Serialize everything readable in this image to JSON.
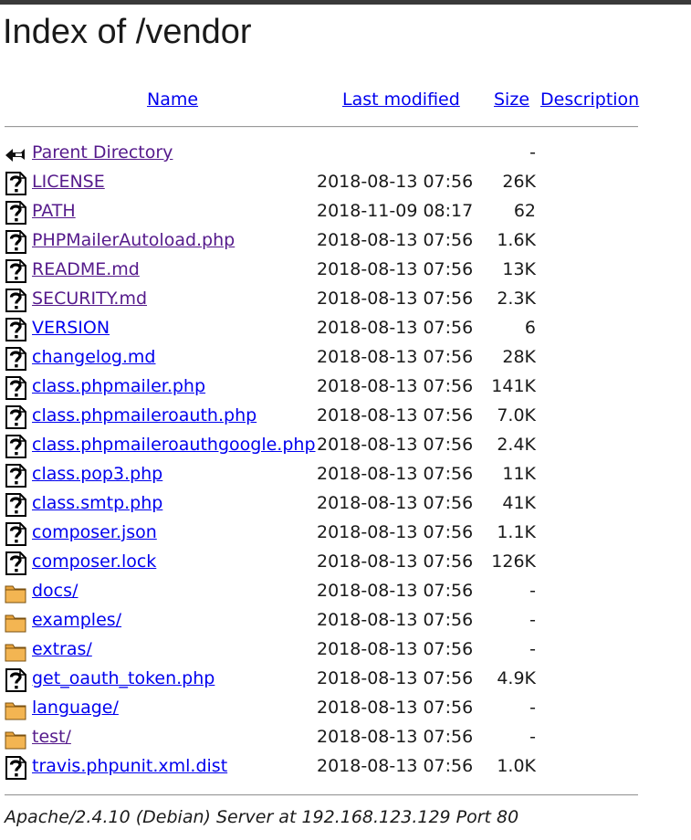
{
  "page": {
    "title": "Index of /vendor"
  },
  "columns": {
    "name": "Name",
    "last_modified": "Last modified",
    "size": "Size",
    "description": "Description"
  },
  "parent": {
    "label": "Parent Directory",
    "size": "-"
  },
  "entries": [
    {
      "name": "LICENSE",
      "modified": "2018-08-13 07:56",
      "size": "26K",
      "icon": "file-unknown-icon",
      "visited": true
    },
    {
      "name": "PATH",
      "modified": "2018-11-09 08:17",
      "size": "62",
      "icon": "file-unknown-icon",
      "visited": true
    },
    {
      "name": "PHPMailerAutoload.php",
      "modified": "2018-08-13 07:56",
      "size": "1.6K",
      "icon": "file-unknown-icon",
      "visited": true
    },
    {
      "name": "README.md",
      "modified": "2018-08-13 07:56",
      "size": "13K",
      "icon": "file-unknown-icon",
      "visited": true
    },
    {
      "name": "SECURITY.md",
      "modified": "2018-08-13 07:56",
      "size": "2.3K",
      "icon": "file-unknown-icon",
      "visited": true
    },
    {
      "name": "VERSION",
      "modified": "2018-08-13 07:56",
      "size": "6",
      "icon": "file-unknown-icon",
      "visited": false
    },
    {
      "name": "changelog.md",
      "modified": "2018-08-13 07:56",
      "size": "28K",
      "icon": "file-unknown-icon",
      "visited": false
    },
    {
      "name": "class.phpmailer.php",
      "modified": "2018-08-13 07:56",
      "size": "141K",
      "icon": "file-unknown-icon",
      "visited": false
    },
    {
      "name": "class.phpmaileroauth.php",
      "modified": "2018-08-13 07:56",
      "size": "7.0K",
      "icon": "file-unknown-icon",
      "visited": false
    },
    {
      "name": "class.phpmaileroauthgoogle.php",
      "modified": "2018-08-13 07:56",
      "size": "2.4K",
      "icon": "file-unknown-icon",
      "visited": false
    },
    {
      "name": "class.pop3.php",
      "modified": "2018-08-13 07:56",
      "size": "11K",
      "icon": "file-unknown-icon",
      "visited": false
    },
    {
      "name": "class.smtp.php",
      "modified": "2018-08-13 07:56",
      "size": "41K",
      "icon": "file-unknown-icon",
      "visited": false
    },
    {
      "name": "composer.json",
      "modified": "2018-08-13 07:56",
      "size": "1.1K",
      "icon": "file-unknown-icon",
      "visited": false
    },
    {
      "name": "composer.lock",
      "modified": "2018-08-13 07:56",
      "size": "126K",
      "icon": "file-unknown-icon",
      "visited": false
    },
    {
      "name": "docs/",
      "modified": "2018-08-13 07:56",
      "size": "-",
      "icon": "folder-icon",
      "visited": false
    },
    {
      "name": "examples/",
      "modified": "2018-08-13 07:56",
      "size": "-",
      "icon": "folder-icon",
      "visited": false
    },
    {
      "name": "extras/",
      "modified": "2018-08-13 07:56",
      "size": "-",
      "icon": "folder-icon",
      "visited": false
    },
    {
      "name": "get_oauth_token.php",
      "modified": "2018-08-13 07:56",
      "size": "4.9K",
      "icon": "file-unknown-icon",
      "visited": false
    },
    {
      "name": "language/",
      "modified": "2018-08-13 07:56",
      "size": "-",
      "icon": "folder-icon",
      "visited": false
    },
    {
      "name": "test/",
      "modified": "2018-08-13 07:56",
      "size": "-",
      "icon": "folder-icon",
      "visited": true
    },
    {
      "name": "travis.phpunit.xml.dist",
      "modified": "2018-08-13 07:56",
      "size": "1.0K",
      "icon": "file-unknown-icon",
      "visited": false
    }
  ],
  "footer": {
    "signature": "Apache/2.4.10 (Debian) Server at 192.168.123.129 Port 80"
  },
  "colors": {
    "link": "#0000ee",
    "visited": "#551a8b",
    "folder": "#e8a33c",
    "text": "#1a1a1a"
  }
}
